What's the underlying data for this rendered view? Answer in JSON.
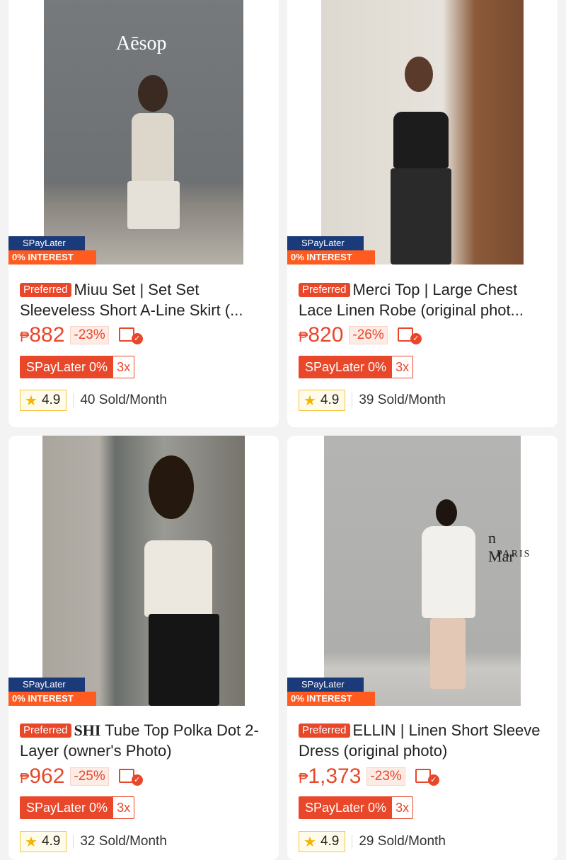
{
  "badge": {
    "top": "SPayLater",
    "bottom": "0% INTEREST"
  },
  "preferred_label": "Preferred",
  "icons": {
    "voucher": "voucher-check-icon",
    "star": "star-icon"
  },
  "colors": {
    "accent": "#e8472a",
    "badge_blue": "#1b3a7a",
    "badge_orange": "#ff5a1f",
    "rating_star": "#f4b400"
  },
  "products": [
    {
      "photo_text": "Aēsop",
      "title": "Miuu Set | Set Set Sleeveless Short A-Line Skirt (...",
      "currency": "₱",
      "price": "882",
      "discount": "-23%",
      "spay_label": "SPayLater 0%",
      "installment": "3x",
      "rating": "4.9",
      "sold": "40 Sold/Month"
    },
    {
      "title": "Merci Top | Large Chest Lace Linen Robe (original phot...",
      "currency": "₱",
      "price": "820",
      "discount": "-26%",
      "spay_label": "SPayLater 0%",
      "installment": "3x",
      "rating": "4.9",
      "sold": "39 Sold/Month"
    },
    {
      "title_brand": "SHI",
      "title": "Tube Top Polka Dot 2-Layer (owner's Photo)",
      "currency": "₱",
      "price": "962",
      "discount": "-25%",
      "spay_label": "SPayLater 0%",
      "installment": "3x",
      "rating": "4.9",
      "sold": "32 Sold/Month"
    },
    {
      "photo_text_line1": "n Mar",
      "photo_text_line2": "PARIS",
      "title": "ELLIN | Linen Short Sleeve Dress (original photo)",
      "currency": "₱",
      "price": "1,373",
      "discount": "-23%",
      "spay_label": "SPayLater 0%",
      "installment": "3x",
      "rating": "4.9",
      "sold": "29 Sold/Month"
    }
  ]
}
